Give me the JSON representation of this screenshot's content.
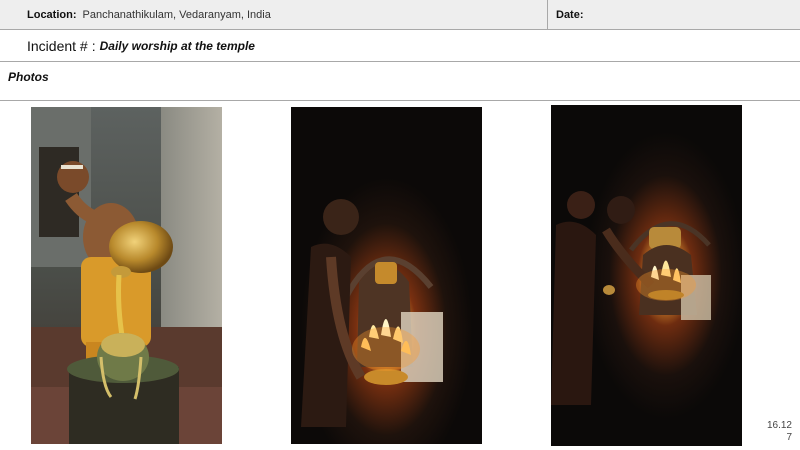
{
  "header": {
    "location_label": "Location:",
    "location_value": "Panchanathikulam, Vedaranyam, India",
    "date_label": "Date:"
  },
  "incident": {
    "label": "Incident #",
    "separator": ":",
    "title": "Daily worship at the temple"
  },
  "photos": {
    "label": "Photos",
    "items": [
      {
        "subject": "priest pouring from brass pot onto lingam"
      },
      {
        "subject": "lamp offering with flames in dark shrine"
      },
      {
        "subject": "lamp offering before idol in dark"
      }
    ]
  },
  "page_number": {
    "line1": "16.12",
    "line2": "7"
  }
}
